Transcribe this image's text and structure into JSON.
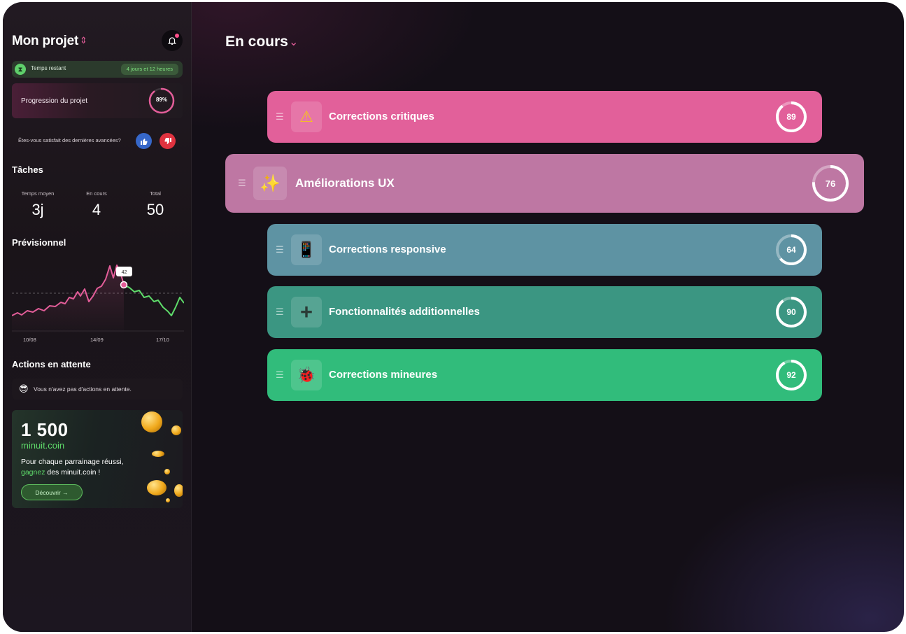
{
  "sidebar": {
    "project_title": "Mon projet",
    "time_label": "Temps restant",
    "time_value": "4 jours et 12 heures",
    "progress_label": "Progression du projet",
    "progress_value": "89%",
    "progress_fraction": 0.89,
    "satisfaction_question": "Êtes-vous satisfait des dernières avancées?",
    "tasks": {
      "title": "Tâches",
      "stats": [
        {
          "label": "Temps moyen",
          "value": "3j"
        },
        {
          "label": "En cours",
          "value": "4"
        },
        {
          "label": "Total",
          "value": "50"
        }
      ]
    },
    "forecast": {
      "title": "Prévisionnel",
      "tooltip": "42",
      "ticks": [
        "10/08",
        "14/09",
        "17/10"
      ]
    },
    "pending": {
      "title": "Actions en attente",
      "message": "Vous n'avez pas d'actions en attente."
    },
    "promo": {
      "amount": "1 500",
      "coin_name": "minuit.coin",
      "desc_before": "Pour chaque parrainage réussi,",
      "desc_highlight": "gagnez",
      "desc_after": " des minuit.coin !",
      "button": "Découvrir →"
    }
  },
  "main": {
    "status_title": "En cours",
    "cards": [
      {
        "label": "Corrections critiques",
        "icon": "warning-icon",
        "glyph": "⚠",
        "score": "89",
        "fraction": 0.89,
        "color": "#e2609a"
      },
      {
        "label": "Améliorations UX",
        "icon": "sparkles-icon",
        "glyph": "✨",
        "score": "76",
        "fraction": 0.76,
        "color": "#be77a3"
      },
      {
        "label": "Corrections responsive",
        "icon": "mobile-phone-icon",
        "glyph": "📱",
        "score": "64",
        "fraction": 0.64,
        "color": "#5e93a3"
      },
      {
        "label": "Fonctionnalités additionnelles",
        "icon": "plus-icon",
        "glyph": "+",
        "score": "90",
        "fraction": 0.9,
        "color": "#3b9682"
      },
      {
        "label": "Corrections mineures",
        "icon": "ladybug-icon",
        "glyph": "🐞",
        "score": "92",
        "fraction": 0.92,
        "color": "#31bc7b"
      }
    ]
  },
  "colors": {
    "accent_pink": "#e35d99",
    "accent_green": "#5edb6a",
    "background": "#140f17"
  }
}
